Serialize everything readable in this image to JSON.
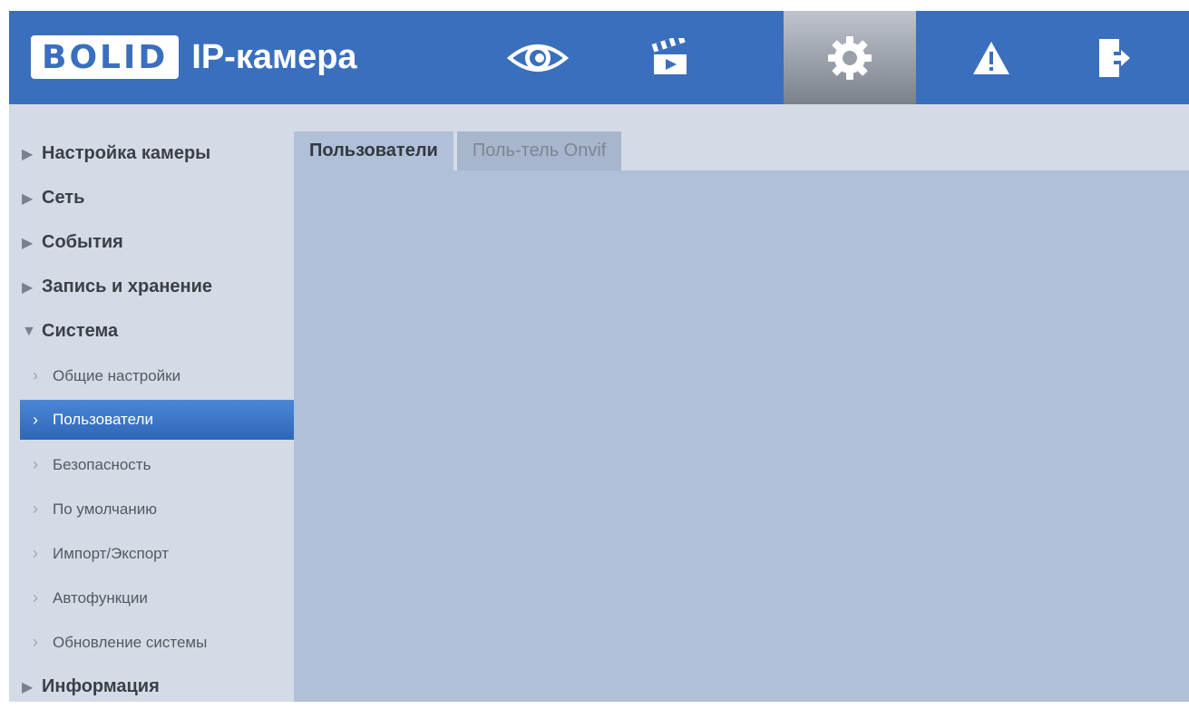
{
  "header": {
    "logo_text": "BOLID",
    "title": "IP-камера",
    "nav": [
      {
        "icon": "eye-icon",
        "label": ""
      },
      {
        "icon": "clapperboard-icon",
        "label": ""
      },
      {
        "icon": "gear-icon",
        "label": ""
      },
      {
        "icon": "warning-icon",
        "label": ""
      },
      {
        "icon": "logout-icon",
        "label": ""
      }
    ],
    "active_nav": "gear-icon"
  },
  "sidebar": {
    "items": [
      {
        "label": "Настройка камеры",
        "level": 0,
        "expanded": false
      },
      {
        "label": "Сеть",
        "level": 0,
        "expanded": false
      },
      {
        "label": "События",
        "level": 0,
        "expanded": false
      },
      {
        "label": "Запись и хранение",
        "level": 0,
        "expanded": false
      },
      {
        "label": "Система",
        "level": 0,
        "expanded": true
      },
      {
        "label": "Общие настройки",
        "level": 1
      },
      {
        "label": "Пользователи",
        "level": 1,
        "active": true
      },
      {
        "label": "Безопасность",
        "level": 1
      },
      {
        "label": "По умолчанию",
        "level": 1
      },
      {
        "label": "Импорт/Экспорт",
        "level": 1
      },
      {
        "label": "Автофункции",
        "level": 1
      },
      {
        "label": "Обновление системы",
        "level": 1
      },
      {
        "label": "Информация",
        "level": 0,
        "expanded": false
      }
    ]
  },
  "main": {
    "tabs": [
      {
        "label": "Пользователи",
        "active": true
      },
      {
        "label": "Поль-тель Onvif",
        "active": false
      }
    ]
  },
  "colors": {
    "header_bg": "#3a6fbd",
    "sidebar_bg": "#d4dbe6",
    "panel_bg": "#b0c0d8",
    "active_item": "#3a72c4"
  }
}
